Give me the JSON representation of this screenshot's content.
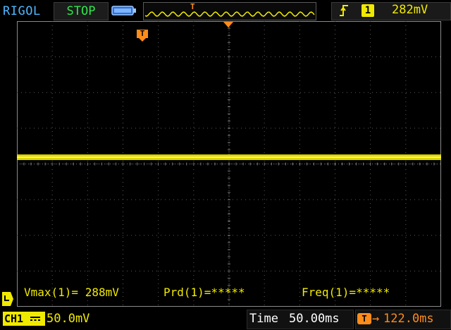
{
  "header": {
    "brand": "RIGOL",
    "run_state": "STOP",
    "trigger_marker_glyph": "T",
    "trigger_edge_icon": "rising-edge-icon",
    "trigger_channel": "1",
    "trigger_level": "282mV"
  },
  "screen": {
    "trigger_position_label": "T",
    "grid": "on",
    "trace_color": "#f0ea00",
    "ground_marker_icon": "channel-ground-icon"
  },
  "measurements": {
    "vmax": "Vmax(1)= 288mV",
    "period": "Prd(1)=*****",
    "frequency": "Freq(1)=*****"
  },
  "footer": {
    "channel": "CH1",
    "coupling_icon": "dc-coupling-icon",
    "volts_per_div": "50.0mV",
    "time_label": "Time",
    "time_per_div": "50.00ms",
    "trigger_offset_badge": "T",
    "trigger_offset_arrow": "→",
    "trigger_offset": "122.0ms"
  },
  "colors": {
    "brand": "#4fb7ff",
    "run_state": "#2fe64c",
    "channel1": "#f0ea00",
    "trigger": "#ff8c1a"
  }
}
